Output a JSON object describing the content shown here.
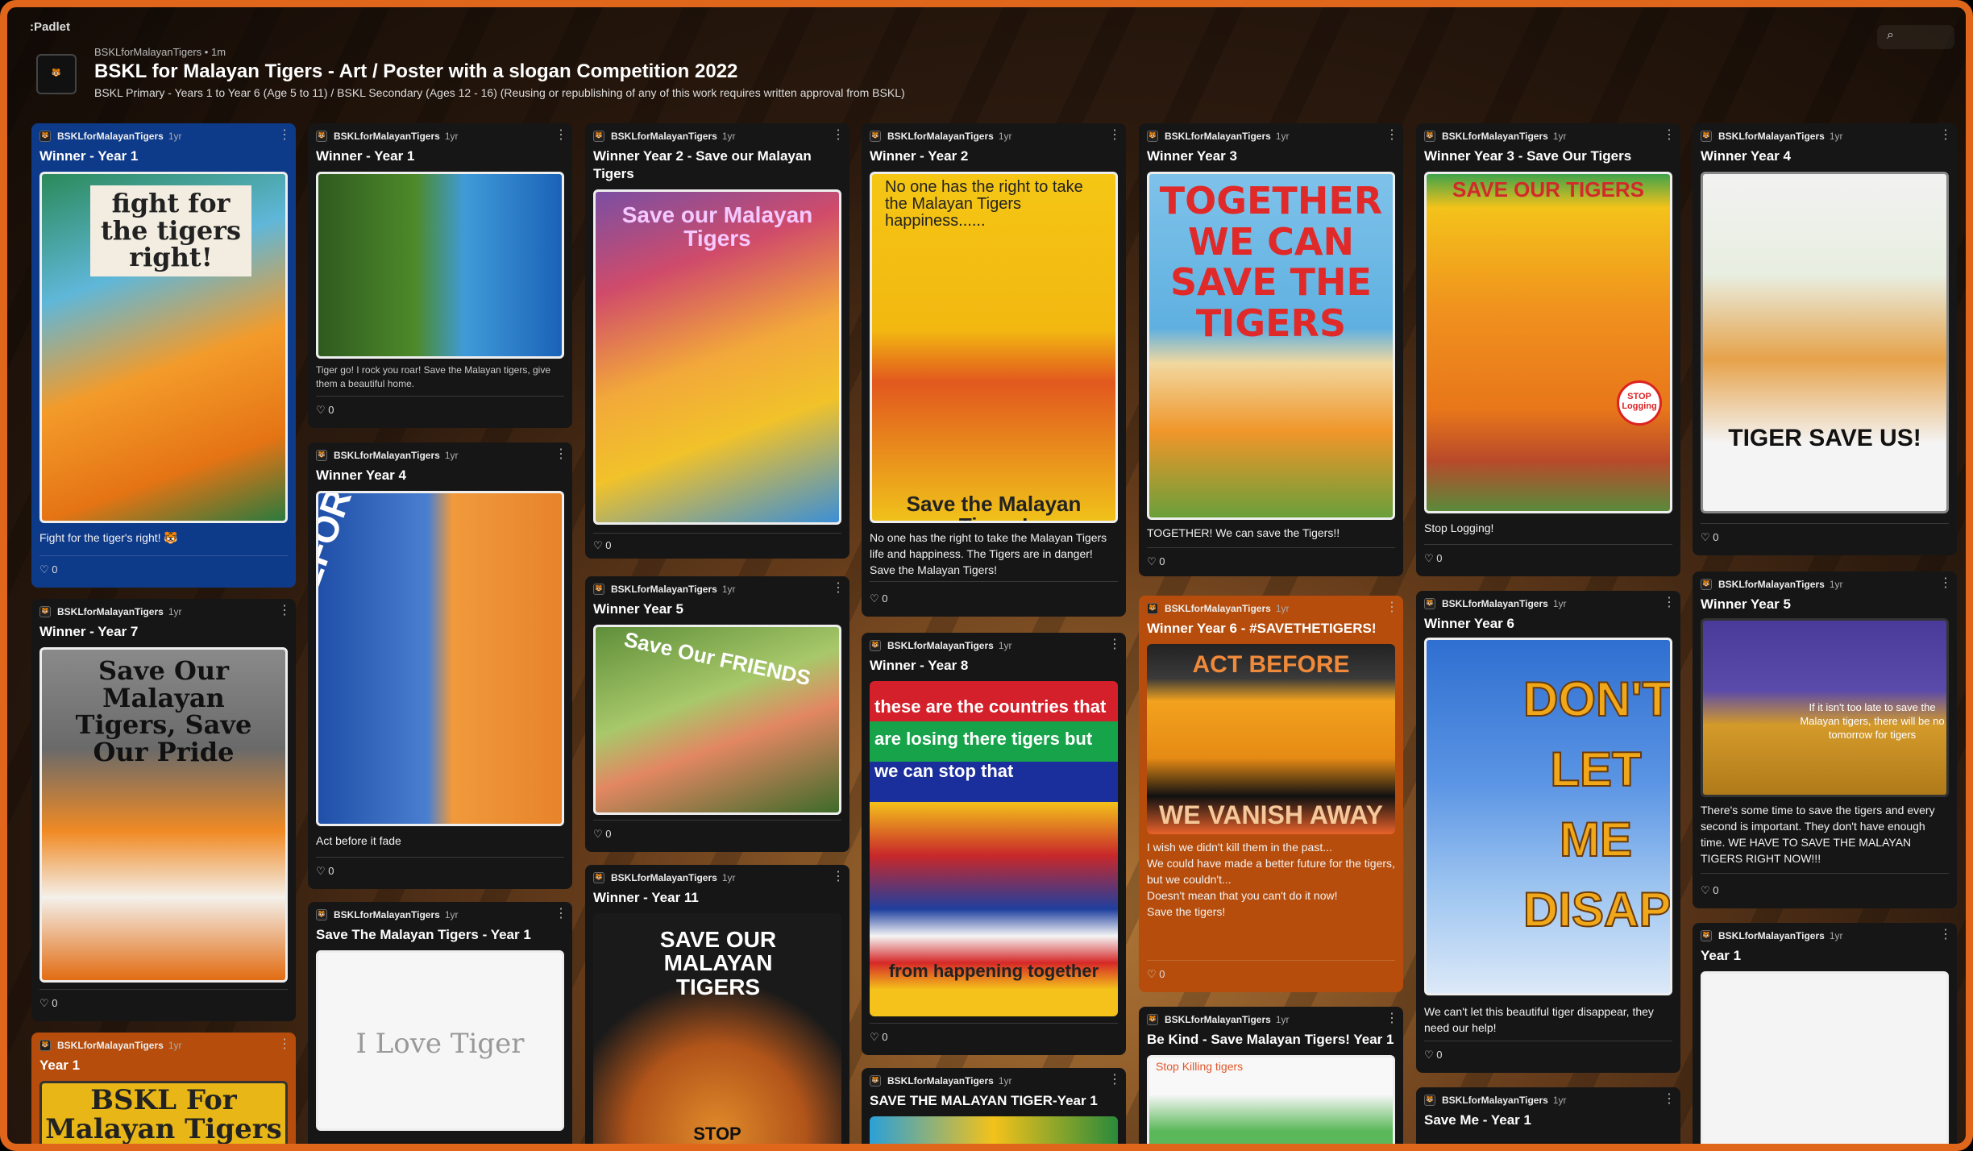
{
  "brand": ":Padlet",
  "header": {
    "author": "BSKLforMalayanTigers",
    "time": "1m",
    "title": "BSKL for Malayan Tigers - Art / Poster with a slogan Competition 2022",
    "subtitle": "BSKL Primary - Years 1 to Year 6 (Age 5 to 11) / BSKL Secondary (Ages 12 - 16) (Reusing or republishing of any of this work requires written approval from BSKL)"
  },
  "search_icon": "search-icon",
  "poster_name": "BSKLforMalayanTigers",
  "age": "1yr",
  "likes": "0",
  "posts": [
    {
      "title": "Winner - Year 1",
      "art_text": "fight for the tigers right!",
      "body": "Fight for the tiger's right! 🐯"
    },
    {
      "title": "Winner - Year 7",
      "art_text": "Save Our Malayan Tigers, Save Our Pride"
    },
    {
      "title": "Year 1",
      "art_text": "BSKL For Malayan Tigers"
    },
    {
      "title": "Winner - Year 1",
      "body": "Tiger go! I rock you roar! Save the Malayan tigers, give them a beautiful home."
    },
    {
      "title": "Winner Year 4",
      "art_text": "ACT BEFORE IT FADE",
      "body": "Act before it fade"
    },
    {
      "title": "Save The Malayan Tigers - Year 1",
      "art_text": "I Love Tiger"
    },
    {
      "title": "Winner Year 2 - Save our Malayan Tigers",
      "art_text": "Save our Malayan Tigers"
    },
    {
      "title": "Winner Year 5",
      "art_text": "Save Our FRIENDS"
    },
    {
      "title": "Winner - Year 11",
      "art_text": "SAVE OUR MALAYAN TIGERS",
      "art_text2": "STOP"
    },
    {
      "title": "Winner - Year 2",
      "art_text": "No one has the right to take the Malayan Tigers happiness......",
      "art_text2": "Save the Malayan Tigers!",
      "body": "No one has the right to take the Malayan Tigers life and happiness. The Tigers are in danger! Save the Malayan Tigers!"
    },
    {
      "title": "Winner - Year 8",
      "art_text": "these are the countries that are losing there tigers but we can stop that",
      "art_text2": "from happening together"
    },
    {
      "title": "SAVE THE MALAYAN TIGER-Year 1"
    },
    {
      "title": "Winner Year 3",
      "art_text": "TOGETHER WE CAN SAVE THE TIGERS",
      "body": "TOGETHER! We can save the Tigers!!"
    },
    {
      "title": "Winner Year 6 - #SAVETHETIGERS!",
      "art_text": "ACT BEFORE",
      "art_text2": "WE VANISH AWAY",
      "body": "I wish we didn't kill them in the past...\nWe could have made a better future for the tigers, but we couldn't...\nDoesn't  mean that you can't do it now!\nSave the tigers!"
    },
    {
      "title": "Be Kind - Save Malayan Tigers! Year 1",
      "art_text": "Stop Killing tigers"
    },
    {
      "title": "Winner Year 3 - Save Our Tigers",
      "art_text": "SAVE OUR TIGERS",
      "art_text2": "STOP Logging",
      "body": "Stop Logging!"
    },
    {
      "title": "Winner Year 6",
      "art_text": "DON'T LET ME DISAPPEAR",
      "body": "We can't let this beautiful tiger disappear, they need our help!"
    },
    {
      "title": "Save Me - Year 1"
    },
    {
      "title": "Winner Year 4",
      "art_text": "TIGER SAVE US!"
    },
    {
      "title": "Winner Year 5",
      "art_text": "If it isn't too late to save the Malayan tigers, there will be no tomorrow for tigers",
      "body": "There's some time to save the tigers and every second is important. They don't have enough time. WE HAVE TO SAVE THE MALAYAN TIGERS RIGHT NOW!!!"
    },
    {
      "title": "Year 1"
    }
  ],
  "colors": {
    "frame": "#e0661c",
    "card": "#161616",
    "card_blue": "#0e3a8a",
    "card_orange": "#b64d0c"
  }
}
